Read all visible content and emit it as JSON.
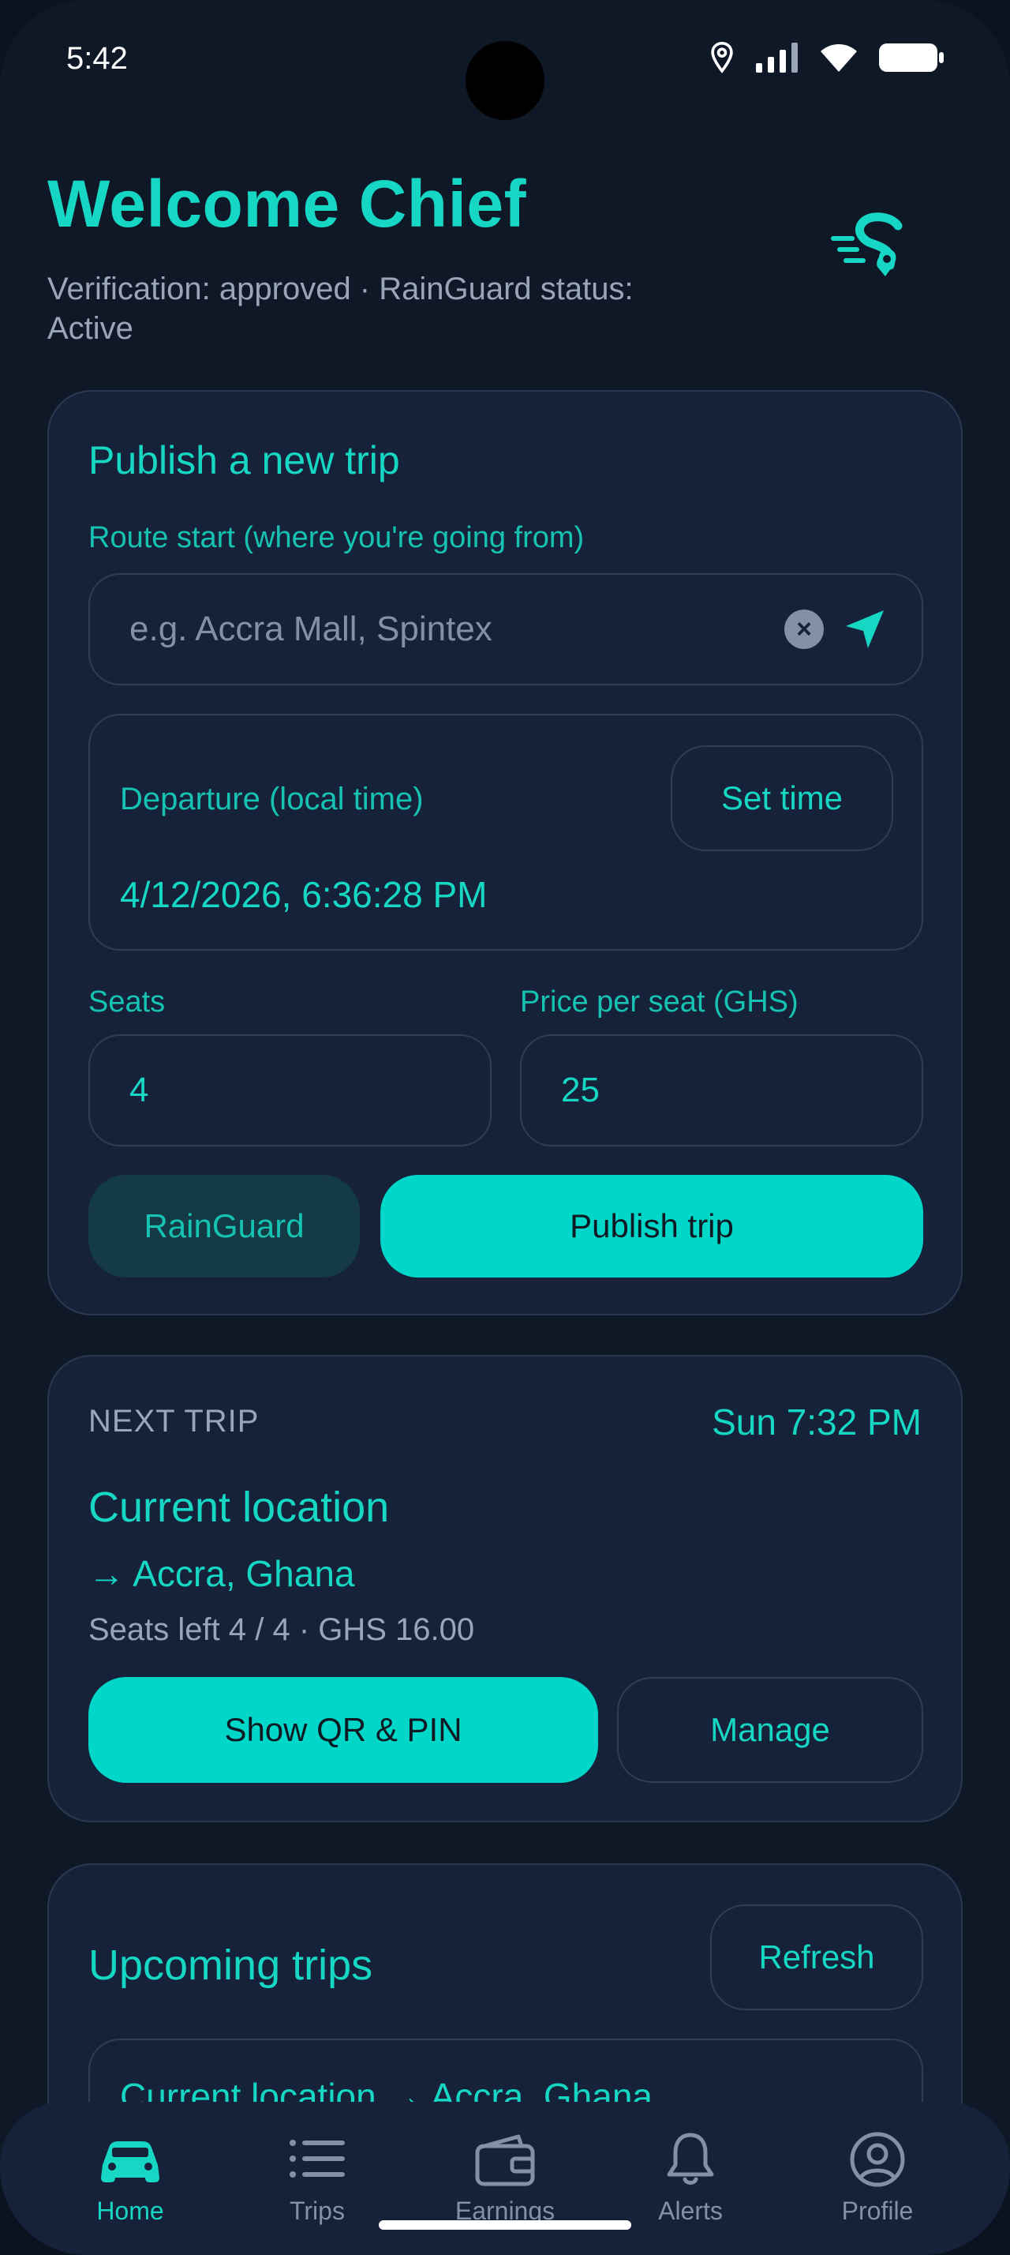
{
  "status_bar": {
    "time": "5:42"
  },
  "header": {
    "title": "Welcome Chief",
    "subtitle": "Verification: approved · RainGuard status: Active"
  },
  "publish": {
    "title": "Publish a new trip",
    "route_label": "Route start (where you're going from)",
    "route_placeholder": "e.g. Accra Mall, Spintex",
    "clear_glyph": "×",
    "departure_label": "Departure (local time)",
    "departure_value": "4/12/2026, 6:36:28 PM",
    "set_time_label": "Set time",
    "seats_label": "Seats",
    "seats_value": "4",
    "price_label": "Price per seat (GHS)",
    "price_value": "25",
    "rainguard_label": "RainGuard",
    "publish_label": "Publish trip"
  },
  "next_trip": {
    "label": "NEXT TRIP",
    "time": "Sun 7:32 PM",
    "from": "Current location",
    "to": "→ Accra, Ghana",
    "meta": "Seats left 4 / 4 · GHS 16.00",
    "show_qr_label": "Show QR & PIN",
    "manage_label": "Manage"
  },
  "upcoming": {
    "title": "Upcoming trips",
    "refresh_label": "Refresh",
    "items": [
      {
        "route": "Current location → Accra, Ghana"
      }
    ]
  },
  "bottom_nav": {
    "items": [
      {
        "label": "Home",
        "icon": "car-icon",
        "active": true
      },
      {
        "label": "Trips",
        "icon": "list-icon",
        "active": false
      },
      {
        "label": "Earnings",
        "icon": "wallet-icon",
        "active": false
      },
      {
        "label": "Alerts",
        "icon": "bell-icon",
        "active": false
      },
      {
        "label": "Profile",
        "icon": "profile-icon",
        "active": false
      }
    ]
  },
  "colors": {
    "accent": "#16d6c4",
    "background": "#0f1827",
    "card": "#16223a",
    "button": "#00d7c8"
  }
}
